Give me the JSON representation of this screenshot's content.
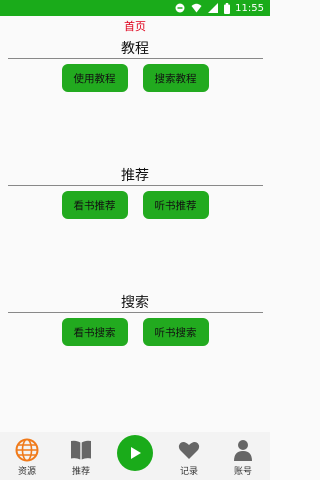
{
  "status_bar": {
    "time": "11:55"
  },
  "page_title": "首页",
  "sections": [
    {
      "title": "教程",
      "buttons": [
        "使用教程",
        "搜索教程"
      ]
    },
    {
      "title": "推荐",
      "buttons": [
        "看书推荐",
        "听书推荐"
      ]
    },
    {
      "title": "搜索",
      "buttons": [
        "看书搜索",
        "听书搜索"
      ]
    }
  ],
  "bottom_nav": {
    "items": [
      {
        "label": "资源",
        "icon": "globe-icon"
      },
      {
        "label": "推荐",
        "icon": "book-icon"
      },
      {
        "label": "",
        "icon": "play-icon"
      },
      {
        "label": "记录",
        "icon": "heart-icon"
      },
      {
        "label": "账号",
        "icon": "user-icon"
      }
    ]
  },
  "colors": {
    "accent": "#1aab1a",
    "button": "#22aa1f",
    "title_red": "#e0001b",
    "globe_orange": "#f07a1a"
  }
}
